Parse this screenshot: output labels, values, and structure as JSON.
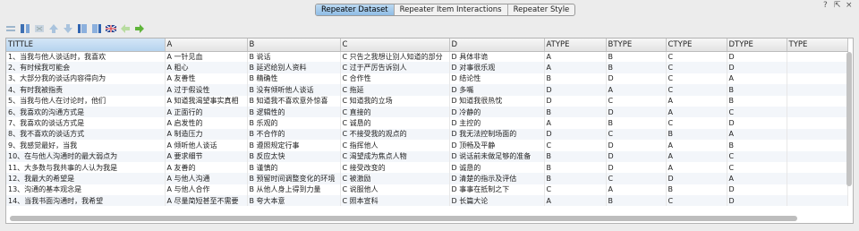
{
  "tabs": [
    {
      "label": "Repeater Dataset",
      "active": true
    },
    {
      "label": "Repeater Item Interactions",
      "active": false
    },
    {
      "label": "Repeater Style",
      "active": false
    }
  ],
  "window_controls": [
    "?",
    "⇱",
    "×"
  ],
  "toolbar": {
    "icons": [
      "insert-row-icon",
      "insert-column-icon",
      "delete-row-icon",
      "move-up-icon",
      "move-down-icon",
      "column-left-icon",
      "column-right-icon",
      "flag-icon",
      "back-arrow-icon",
      "forward-arrow-icon"
    ]
  },
  "grid": {
    "columns": [
      "TITTLE",
      "A",
      "B",
      "C",
      "D",
      "ATYPE",
      "BTYPE",
      "CTYPE",
      "DTYPE",
      "TYPE"
    ],
    "rows": [
      [
        "1、当我与他人谈话时，我喜欢",
        "A 一针见血",
        "B 说话",
        "C 只告之我想让别人知道的部分",
        "D 具体非诡",
        "A",
        "B",
        "C",
        "D",
        ""
      ],
      [
        "2、有时候我可能会",
        "A 粗心",
        "B 延迟给别人资料",
        "C 过于严厉告诉别人",
        "D 对事很乐观",
        "A",
        "B",
        "C",
        "D",
        ""
      ],
      [
        "3、大部分我的谈话内容得向为",
        "A 友善性",
        "B 精确性",
        "C 合作性",
        "D 结论性",
        "B",
        "D",
        "C",
        "A",
        ""
      ],
      [
        "4、有时我被指责",
        "A 过于假设性",
        "B 没有倾听他人谈话",
        "C 拖延",
        "D 多嘴",
        "D",
        "A",
        "C",
        "B",
        ""
      ],
      [
        "5、当我与他人在讨论时，他们",
        "A 知道我渴望事实真相",
        "B 知道我不喜欢意外惊喜",
        "C 知道我的立场",
        "D 知道我很热忱",
        "D",
        "C",
        "A",
        "B",
        ""
      ],
      [
        "6、我喜欢的沟通方式是",
        "A 正面行的",
        "B 逻辑性的",
        "C 直接的",
        "D 冷静的",
        "B",
        "D",
        "A",
        "C",
        ""
      ],
      [
        "7、我喜欢的谈话方式是",
        "A 启发性的",
        "B 乐观的",
        "C 诚恳的",
        "D 主控的",
        "A",
        "B",
        "C",
        "D",
        ""
      ],
      [
        "8、我不喜欢的谈话方式",
        "A 制造压力",
        "B 不合作的",
        "C 不接受我的观点的",
        "D 我无法控制场面的",
        "D",
        "C",
        "B",
        "A",
        ""
      ],
      [
        "9、我感觉最好，当我",
        "A 倾听他人谈话",
        "B 遵照规定行事",
        "C 指挥他人",
        "D 顶畅及平静",
        "C",
        "D",
        "A",
        "B",
        ""
      ],
      [
        "10、在与他人沟通时的最大弱点为",
        "A 要求细节",
        "B 反应太快",
        "C 渴望成为焦点人物",
        "D 说话前未做足够的准备",
        "B",
        "D",
        "A",
        "C",
        ""
      ],
      [
        "11、大多数与我共事的人认为我是",
        "A 友善的",
        "B 谨慎的",
        "C 接受改变的",
        "D 诚恳的",
        "B",
        "D",
        "A",
        "C",
        ""
      ],
      [
        "12、我最大的希望是",
        "A 与他人沟通",
        "B 预留时间调整变化的环境",
        "C 被激励",
        "D 清楚的指示及评估",
        "B",
        "C",
        "D",
        "A",
        ""
      ],
      [
        "13、沟通的基本观念是",
        "A 与他人合作",
        "B 从他人身上得到力量",
        "C 说服他人",
        "D 事事在抵制之下",
        "C",
        "A",
        "B",
        "D",
        ""
      ],
      [
        "14、当我书面沟通时，我希望",
        "A 尽量简短甚至不需要",
        "B 夸大本意",
        "C 照本宣科",
        "D 长篇大论",
        "A",
        "B",
        "C",
        "D",
        ""
      ]
    ]
  }
}
